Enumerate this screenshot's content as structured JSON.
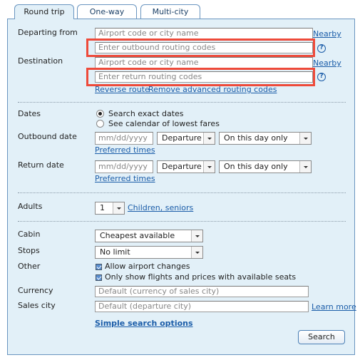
{
  "tabs": [
    {
      "label": "Round trip",
      "active": true
    },
    {
      "label": "One-way",
      "active": false
    },
    {
      "label": "Multi-city",
      "active": false
    }
  ],
  "route": {
    "departing_label": "Departing from",
    "departing_placeholder": "Airport code or city name",
    "outbound_routing_placeholder": "Enter outbound routing codes",
    "destination_label": "Destination",
    "destination_placeholder": "Airport code or city name",
    "return_routing_placeholder": "Enter return routing codes",
    "nearby_link": "Nearby",
    "help_icon": "?",
    "reverse_route_link": "Reverse route",
    "remove_routing_link": "Remove advanced routing codes"
  },
  "dates": {
    "label": "Dates",
    "options": [
      {
        "label": "Search exact dates",
        "selected": true
      },
      {
        "label": "See calendar of lowest fares",
        "selected": false
      }
    ],
    "outbound_label": "Outbound date",
    "return_label": "Return date",
    "date_placeholder": "mm/dd/yyyy",
    "time_type": "Departure",
    "flex": "On this day only",
    "preferred_times_link": "Preferred times"
  },
  "passengers": {
    "adults_label": "Adults",
    "adults_value": "1",
    "children_link": "Children, seniors"
  },
  "options": {
    "cabin_label": "Cabin",
    "cabin_value": "Cheapest available",
    "stops_label": "Stops",
    "stops_value": "No limit",
    "other_label": "Other",
    "checkboxes": [
      {
        "label": "Allow airport changes",
        "checked": true
      },
      {
        "label": "Only show flights and prices with available seats",
        "checked": true
      }
    ],
    "currency_label": "Currency",
    "currency_placeholder": "Default (currency of sales city)",
    "sales_city_label": "Sales city",
    "sales_city_placeholder": "Default (departure city)",
    "learn_more_link": "Learn more",
    "simple_search_link": "Simple search options",
    "search_button": "Search"
  },
  "colors": {
    "panel_bg": "#e2f0f8",
    "border": "#6a95c0",
    "link": "#1a5ca8",
    "highlight": "#ee4a3a"
  }
}
